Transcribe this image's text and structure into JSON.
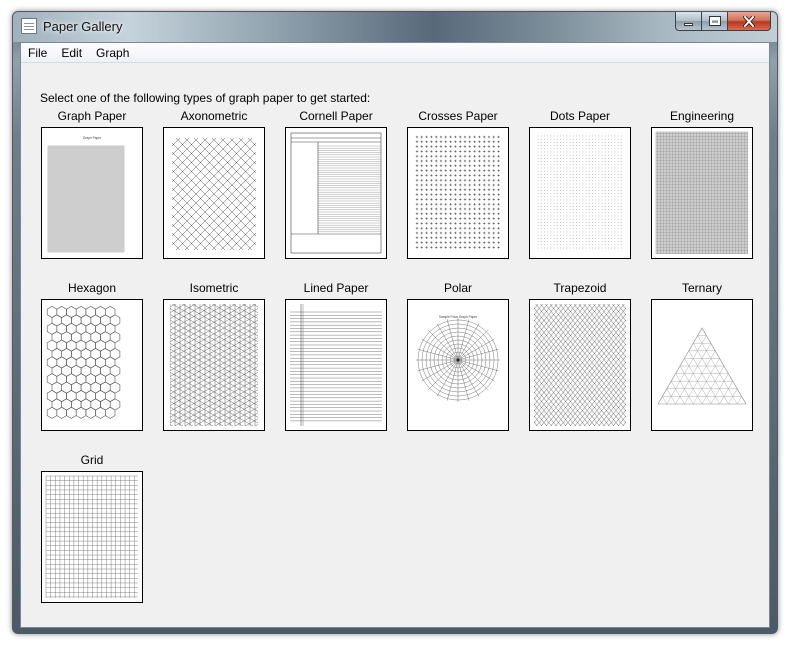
{
  "window": {
    "title": "Paper Gallery"
  },
  "menu": [
    "File",
    "Edit",
    "Graph"
  ],
  "intro": "Select one of the following types of graph paper to get started:",
  "papers": [
    {
      "label": "Graph Paper",
      "icon": "graph-paper-thumbnail",
      "caption": "Graph Paper"
    },
    {
      "label": "Axonometric",
      "icon": "axonometric-thumbnail"
    },
    {
      "label": "Cornell Paper",
      "icon": "cornell-paper-thumbnail"
    },
    {
      "label": "Crosses Paper",
      "icon": "crosses-paper-thumbnail"
    },
    {
      "label": "Dots Paper",
      "icon": "dots-paper-thumbnail"
    },
    {
      "label": "Engineering",
      "icon": "engineering-thumbnail"
    },
    {
      "label": "Hexagon",
      "icon": "hexagon-thumbnail"
    },
    {
      "label": "Isometric",
      "icon": "isometric-thumbnail"
    },
    {
      "label": "Lined Paper",
      "icon": "lined-paper-thumbnail"
    },
    {
      "label": "Polar",
      "icon": "polar-thumbnail",
      "caption": "Sample Polar Graph Paper"
    },
    {
      "label": "Trapezoid",
      "icon": "trapezoid-thumbnail"
    },
    {
      "label": "Ternary",
      "icon": "ternary-thumbnail"
    },
    {
      "label": "Grid",
      "icon": "grid-thumbnail"
    }
  ]
}
